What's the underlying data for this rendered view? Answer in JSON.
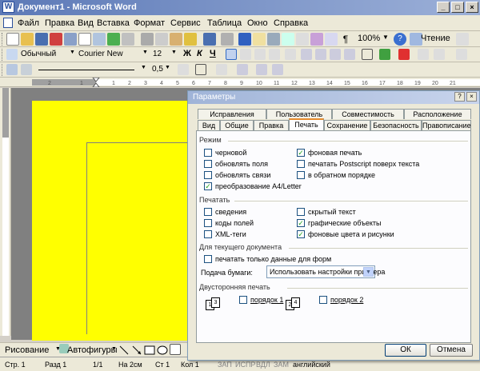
{
  "window": {
    "title": "Документ1 - Microsoft Word",
    "app_icon": "word-icon"
  },
  "menu": {
    "items": [
      "Файл",
      "Правка",
      "Вид",
      "Вставка",
      "Формат",
      "Сервис",
      "Таблица",
      "Окно",
      "Справка"
    ]
  },
  "toolbar": {
    "zoom": "100%",
    "read_label": "Чтение",
    "style": "Обычный",
    "font": "Courier New",
    "size": "12",
    "spacing": "0,5"
  },
  "drawing": {
    "draw_label": "Рисование",
    "autoshapes_label": "Автофигуры"
  },
  "status": {
    "page": "Стр.  1",
    "section": "Разд  1",
    "pages": "1/1",
    "at": "На  2см",
    "line": "Ст  1",
    "col": "Кол  1",
    "rec": "ЗАП",
    "trk": "ИСПР",
    "ext": "ВДЛ",
    "ovr": "ЗАМ",
    "lang": "английский"
  },
  "dialog": {
    "title": "Параметры",
    "help_glyph": "?",
    "close_glyph": "×",
    "tabs_row1": [
      "Исправления",
      "Пользователь",
      "Совместимость",
      "Расположение"
    ],
    "tabs_row2": [
      "Вид",
      "Общие",
      "Правка",
      "Печать",
      "Сохранение",
      "Безопасность",
      "Правописание"
    ],
    "active_tab": "Печать",
    "mode": {
      "heading": "Режим",
      "options": [
        {
          "label": "черновой",
          "checked": false
        },
        {
          "label": "фоновая печать",
          "checked": true
        },
        {
          "label": "обновлять поля",
          "checked": false
        },
        {
          "label": "печатать Postscript поверх текста",
          "checked": false
        },
        {
          "label": "обновлять связи",
          "checked": false
        },
        {
          "label": "в обратном порядке",
          "checked": false
        },
        {
          "label": "преобразование A4/Letter",
          "checked": true
        }
      ]
    },
    "print": {
      "heading": "Печатать",
      "options": [
        {
          "label": "сведения",
          "checked": false
        },
        {
          "label": "скрытый текст",
          "checked": false
        },
        {
          "label": "коды полей",
          "checked": false
        },
        {
          "label": "графические объекты",
          "checked": true
        },
        {
          "label": "XML-теги",
          "checked": false
        },
        {
          "label": "фоновые цвета и рисунки",
          "checked": true
        }
      ]
    },
    "current_doc": {
      "heading": "Для текущего документа",
      "only_form_data": {
        "label": "печатать только данные для форм",
        "checked": false
      },
      "paper_feed_label": "Подача бумаги:",
      "paper_feed_value": "Использовать настройки принтера"
    },
    "duplex": {
      "heading": "Двусторонняя печать",
      "order1": {
        "label": "порядок 1",
        "checked": false
      },
      "order2": {
        "label": "порядок 2",
        "checked": false
      },
      "icon1_pages": [
        "1",
        "3"
      ],
      "icon2_pages": [
        "2",
        "4"
      ]
    },
    "ok_label": "ОК",
    "cancel_label": "Отмена"
  },
  "colors": {
    "page_background": "#ffff00",
    "accent_tab": "#e68b2c"
  }
}
